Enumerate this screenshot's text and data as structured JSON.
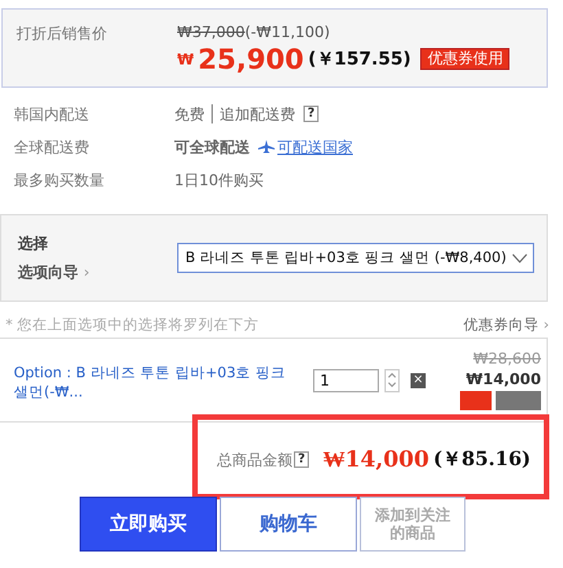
{
  "price_box": {
    "label": "打折后销售价",
    "original_price": "₩37,000",
    "discount": "(-₩11,100)",
    "currency_mark": "₩",
    "price": "25,900",
    "converted": "(￥157.55)",
    "coupon_button": "优惠券使用"
  },
  "info_rows": [
    {
      "kind": "shipping",
      "label": "韩国内配送",
      "value": "免费",
      "extra": "追加配送费",
      "help": "?"
    },
    {
      "kind": "global",
      "label": "全球配送费",
      "value": "可全球配送",
      "link": "可配送国家"
    },
    {
      "kind": "plain",
      "label": "最多购买数量",
      "value": "1日10件购买"
    }
  ],
  "option_box": {
    "label": "选择",
    "guide": "选项向导",
    "guide_arrow": "›",
    "selected_option": "B 라네즈 투톤 립바+03호 핑크 샐먼 (-₩8,400)"
  },
  "note": "* 您在上面选项中的选择将罗列在下方",
  "coupon_guide": "优惠券向导",
  "coupon_guide_arrow": "›",
  "selected_item": {
    "name": "Option : B 라네즈 투톤 립바+03호 핑크 샐먼(-₩...",
    "quantity": "1",
    "remove": "×",
    "old_price": "₩28,600",
    "price": "₩14,000"
  },
  "total": {
    "label": "总商品金额",
    "help": "?",
    "amount": "₩14,000",
    "converted": "(￥85.16)"
  },
  "buttons": [
    {
      "kind": "primary",
      "label": "立即购买"
    },
    {
      "kind": "secondary",
      "label": "购物车"
    },
    {
      "kind": "muted",
      "label": "添加到关注的商品"
    }
  ]
}
